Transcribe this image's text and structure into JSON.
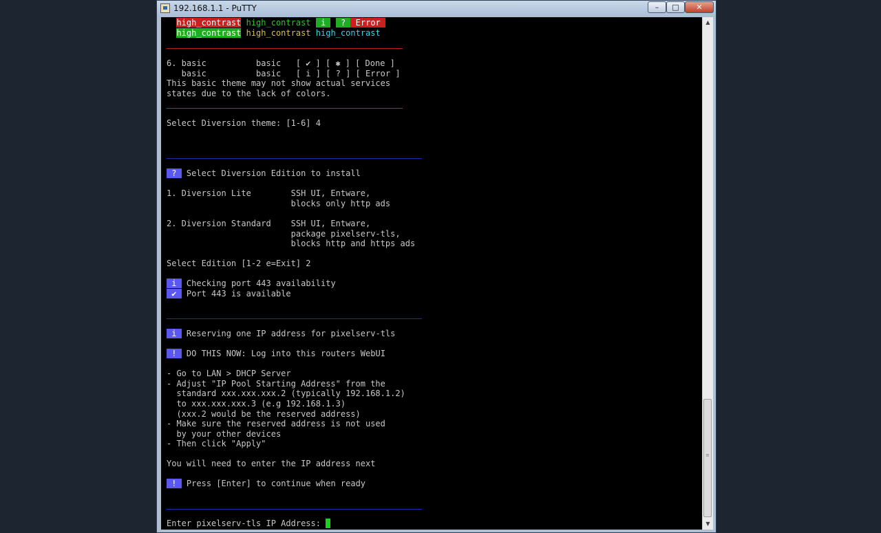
{
  "window": {
    "title": "192.168.1.1 - PuTTY",
    "min": "–",
    "max": "□",
    "close": "✕"
  },
  "themes": {
    "hc_a": "high_contrast",
    "hc_b": "high_contrast",
    "hc_i": "i",
    "hc_q": "?",
    "hc_error": "Error",
    "hc_c": "high_contrast",
    "hc_d": "high_contrast",
    "hc_e": "high_contrast",
    "basic_line1_pre": "6. basic          basic   [ ",
    "basic_check": "✔",
    "basic_line1_mid": " ] [ ",
    "basic_star": "✱",
    "basic_line1_post": " ] [ Done ]",
    "basic_line2": "   basic          basic   [ i ] [ ? ] [ Error ]",
    "note1": "This basic theme may not show actual services",
    "note2": "states due to the lack of colors.",
    "select_theme": "Select Diversion theme: [1-6] 4"
  },
  "edition": {
    "q_badge": "?",
    "q_text": " Select Diversion Edition to install",
    "lite1": "1. Diversion Lite        SSH UI, Entware,",
    "lite2": "                         blocks only http ads",
    "std1": "2. Diversion Standard    SSH UI, Entware,",
    "std2": "                         package pixelserv-tls,",
    "std3": "                         blocks http and https ads",
    "select_edition": "Select Edition [1-2 e=Exit] 2",
    "i_badge": "i",
    "check_port": " Checking port 443 availability",
    "ok_badge": "✔",
    "port_ok": " Port 443 is available"
  },
  "reserve": {
    "i_badge": "i",
    "reserve_text": " Reserving one IP address for pixelserv-tls",
    "ex_badge": "!",
    "do_now": " DO THIS NOW: Log into this routers WebUI",
    "l1": "- Go to LAN > DHCP Server",
    "l2": "- Adjust \"IP Pool Starting Address\" from the",
    "l3": "  standard xxx.xxx.xxx.2 (typically 192.168.1.2)",
    "l4": "  to xxx.xxx.xxx.3 (e.g 192.168.1.3)",
    "l5": "  (xxx.2 would be the reserved address)",
    "l6": "- Make sure the reserved address is not used",
    "l7": "  by your other devices",
    "l8": "- Then click \"Apply\"",
    "need_ip": "You will need to enter the IP address next",
    "ex2_badge": "!",
    "press_enter": " Press [Enter] to continue when ready",
    "prompt": "Enter pixelserv-tls IP Address: "
  },
  "colors": {
    "red": "#cc1f1f",
    "green": "#1fae1f",
    "blue_badge": "#5a58f0",
    "cursor": "#19d319"
  }
}
